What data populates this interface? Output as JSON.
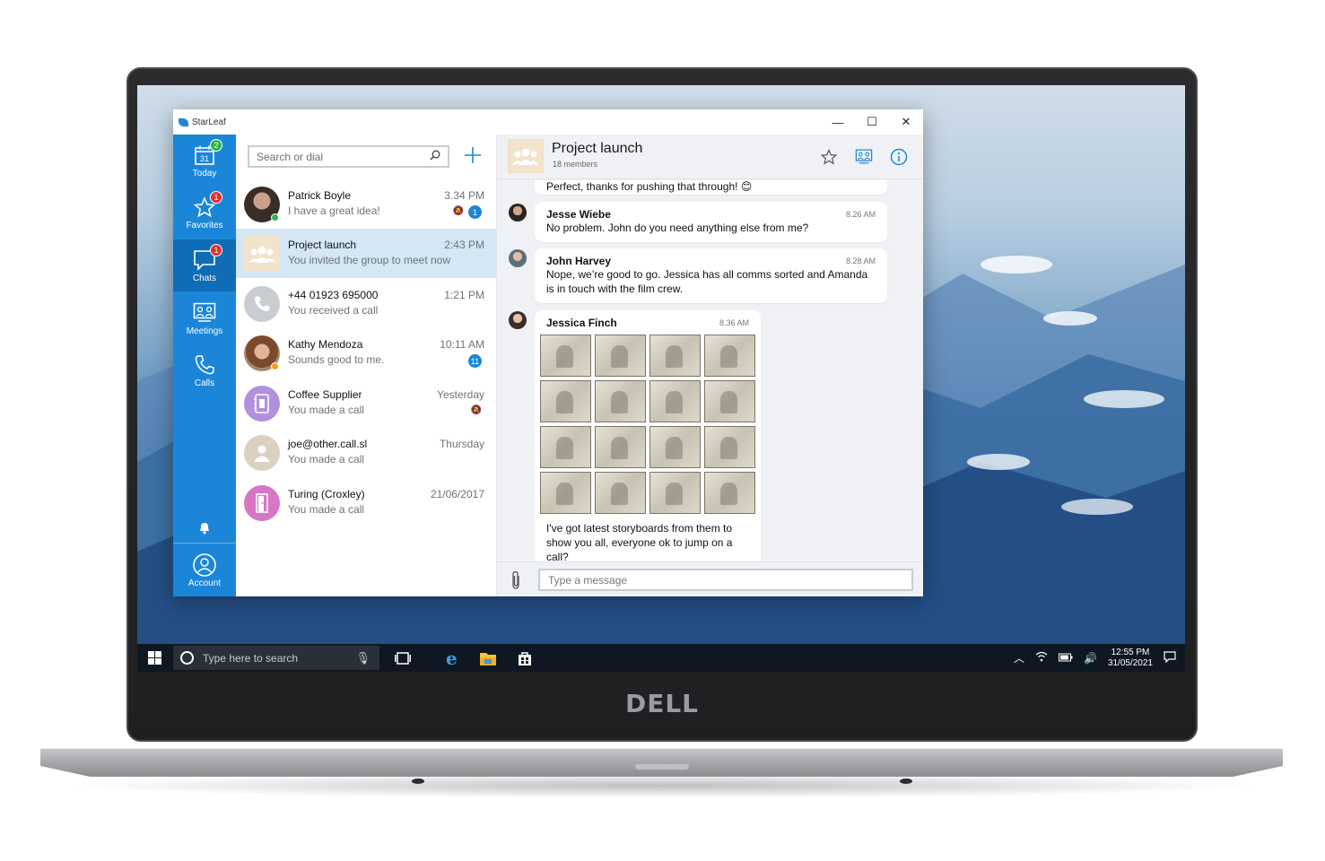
{
  "app": {
    "title": "StarLeaf",
    "window_controls": {
      "minimize": "—",
      "maximize": "☐",
      "close": "✕"
    }
  },
  "sidebar": {
    "items": [
      {
        "label": "Today",
        "icon": "calendar-icon",
        "calendar_day": "31",
        "badge": "2",
        "badge_color": "#2fb24a"
      },
      {
        "label": "Favorites",
        "icon": "star-icon",
        "badge": "1",
        "badge_color": "#e02f2f"
      },
      {
        "label": "Chats",
        "icon": "chat-icon",
        "badge": "1",
        "badge_color": "#e02f2f",
        "active": true
      },
      {
        "label": "Meetings",
        "icon": "meetings-icon"
      },
      {
        "label": "Calls",
        "icon": "phone-icon"
      }
    ],
    "notifications_icon": "bell-icon",
    "account": {
      "label": "Account",
      "icon": "account-icon"
    },
    "color": "#1b86d8"
  },
  "list": {
    "search_placeholder": "Search or dial",
    "add_icon": "plus-icon",
    "conversations": [
      {
        "name": "Patrick Boyle",
        "preview": "I have a great idea!",
        "time": "3.34 PM",
        "unread": "1",
        "muted": true,
        "presence": "#2fb24a"
      },
      {
        "name": "Project launch",
        "preview": "You invited the group to meet now",
        "time": "2:43 PM",
        "active": true
      },
      {
        "name": "+44 01923 695000",
        "preview": "You received a call",
        "time": "1:21 PM"
      },
      {
        "name": "Kathy Mendoza",
        "preview": "Sounds good to me.",
        "time": "10:11 AM",
        "unread": "11",
        "presence": "#f0a020"
      },
      {
        "name": "Coffee Supplier",
        "preview": "You made a call",
        "time": "Yesterday",
        "muted": true
      },
      {
        "name": "joe@other.call.sl",
        "preview": "You made a call",
        "time": "Thursday"
      },
      {
        "name": "Turing (Croxley)",
        "preview": "You made a call",
        "time": "21/06/2017"
      }
    ]
  },
  "chat": {
    "title": "Project launch",
    "members": "18 members",
    "messages": [
      {
        "text": "Perfect, thanks for pushing that through! 😊"
      },
      {
        "author": "Jesse Wiebe",
        "time": "8.26 AM",
        "text": "No problem. John do you need anything else from me?"
      },
      {
        "author": "John Harvey",
        "time": "8.28 AM",
        "text": "Nope, we’re good to go. Jessica has all comms sorted and Amanda is in touch with the film crew."
      },
      {
        "author": "Jessica Finch",
        "time": "8.36 AM",
        "text": "I've got latest storyboards from them to show you all, everyone ok to jump on a call?",
        "attachment": "storyboard-image"
      }
    ],
    "composer_placeholder": "Type a message"
  },
  "taskbar": {
    "search_placeholder": "Type here to search",
    "time": "12:55 PM",
    "date": "31/05/2021"
  },
  "device": {
    "brand": "DELL"
  }
}
